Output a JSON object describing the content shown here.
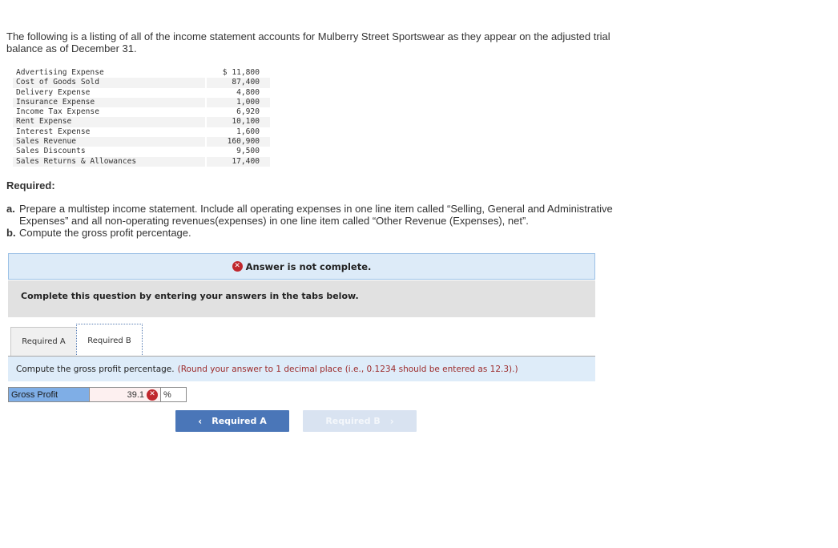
{
  "intro": {
    "text": "The following is a listing of all of the income statement accounts for Mulberry Street Sportswear as they appear on the adjusted trial balance as of December 31."
  },
  "accounts": [
    {
      "name": "Advertising Expense",
      "amount": "$ 11,800"
    },
    {
      "name": "Cost of Goods Sold",
      "amount": "87,400"
    },
    {
      "name": "Delivery Expense",
      "amount": "4,800"
    },
    {
      "name": "Insurance Expense",
      "amount": "1,000"
    },
    {
      "name": "Income Tax Expense",
      "amount": "6,920"
    },
    {
      "name": "Rent Expense",
      "amount": "10,100"
    },
    {
      "name": "Interest Expense",
      "amount": "1,600"
    },
    {
      "name": "Sales Revenue",
      "amount": "160,900"
    },
    {
      "name": "Sales Discounts",
      "amount": "9,500"
    },
    {
      "name": "Sales Returns & Allowances",
      "amount": "17,400"
    }
  ],
  "required": {
    "heading": "Required:",
    "items": [
      {
        "marker": "a.",
        "text": "Prepare a multistep income statement. Include all operating expenses in one line item called “Selling, General and Administrative Expenses” and all non-operating revenues(expenses) in one line item called “Other Revenue (Expenses), net”."
      },
      {
        "marker": "b.",
        "text": "Compute the gross profit percentage."
      }
    ]
  },
  "alert": {
    "icon": "error-x-icon",
    "text": "Answer is not complete."
  },
  "instructions": "Complete this question by entering your answers in the tabs below.",
  "tabs": [
    {
      "label": "Required A",
      "active": false
    },
    {
      "label": "Required B",
      "active": true
    }
  ],
  "question": {
    "text": "Compute the gross profit percentage.",
    "hint": "(Round your answer to 1 decimal place (i.e., 0.1234 should be entered as 12.3).)"
  },
  "answer": {
    "label": "Gross Profit",
    "value": "39.1",
    "status": "incorrect",
    "unit": "%"
  },
  "navigation": {
    "prev_label": "Required A",
    "next_label": "Required B",
    "prev_icon": "‹",
    "next_icon": "›"
  },
  "colors": {
    "error": "#c0272d",
    "alert_bg": "#ddebf8",
    "nav_active": "#4a76b8",
    "nav_disabled": "#d9e3f1",
    "hint": "#9c2a2a"
  }
}
